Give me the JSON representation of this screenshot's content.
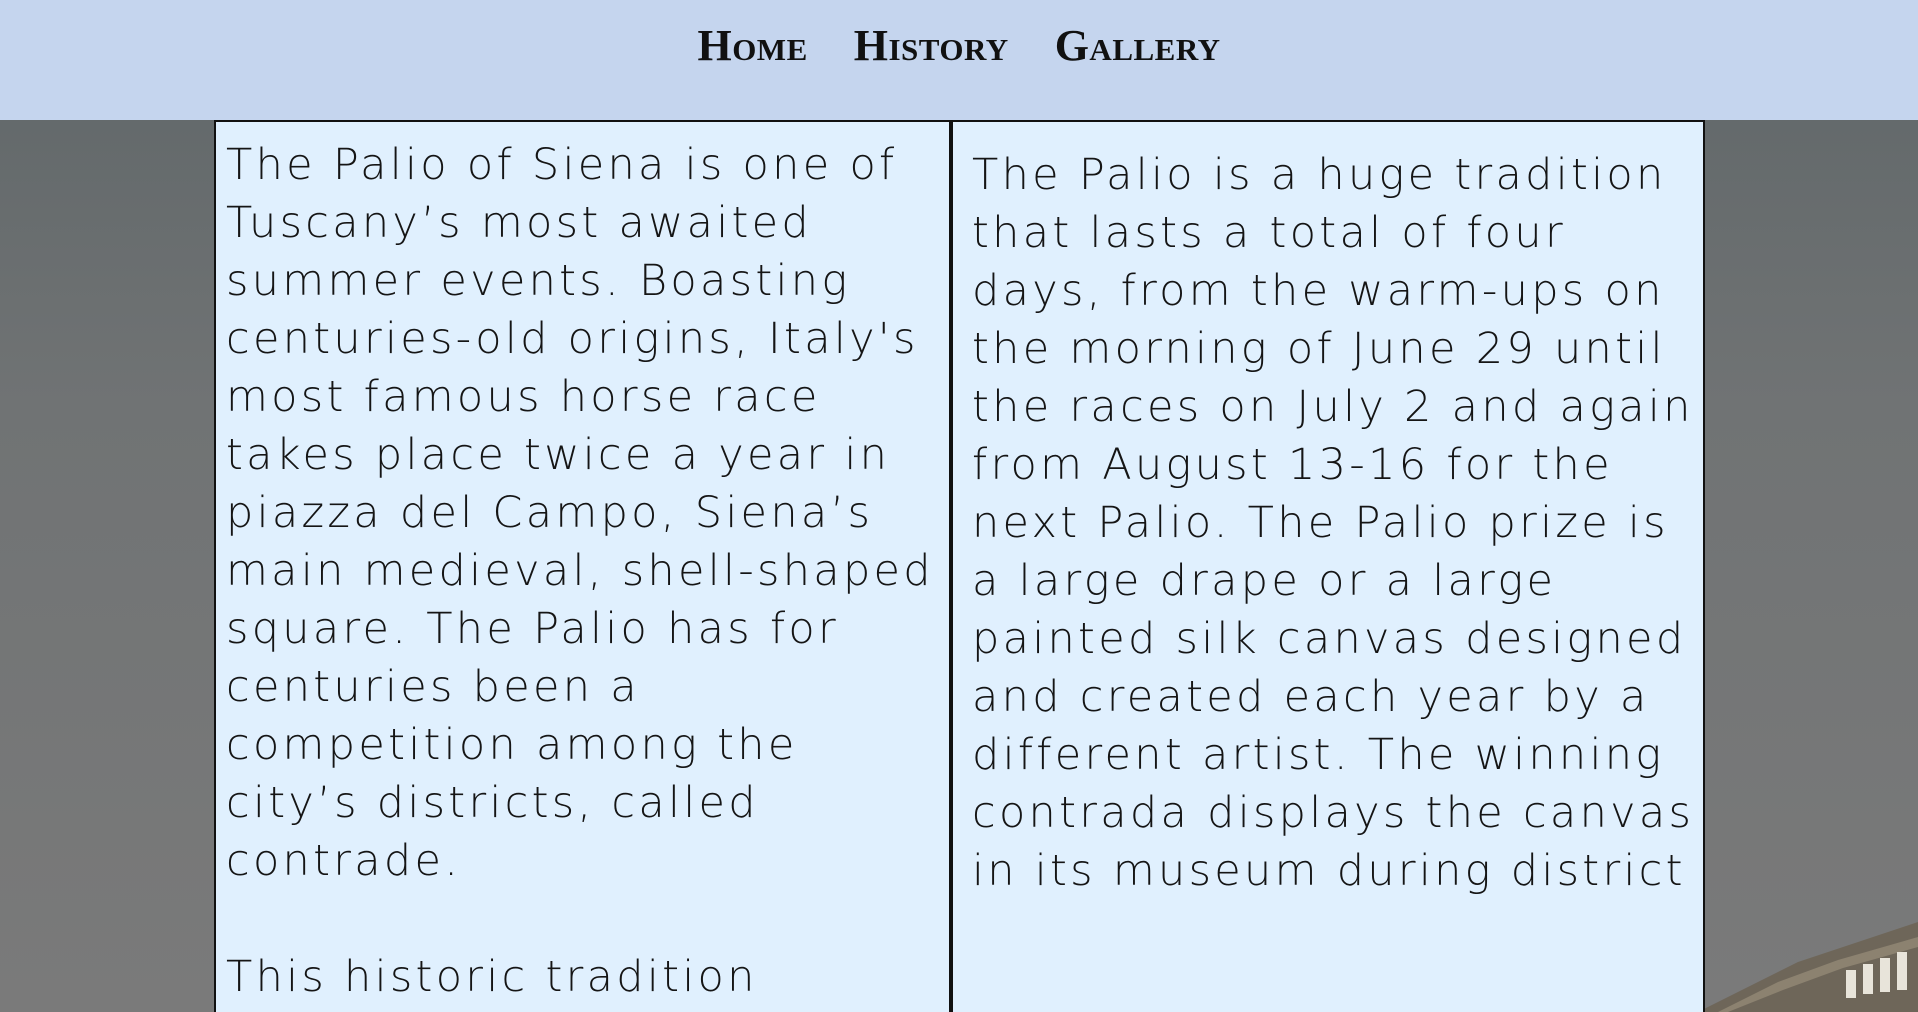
{
  "nav": {
    "links": [
      {
        "label": "Home"
      },
      {
        "label": "History"
      },
      {
        "label": "Gallery"
      }
    ]
  },
  "content": {
    "left": {
      "paragraphs": [
        "The Palio of Siena is one of Tuscany’s most awaited summer events. Boasting centuries-old origins, Italy's most famous horse race takes place twice a year in piazza del Campo, Siena’s main medieval, shell-shaped square. The Palio has for centuries been a competition among the city’s districts, called contrade.",
        "This historic tradition"
      ]
    },
    "right": {
      "paragraphs": [
        "The Palio is a huge tradition that lasts a total of four days, from the warm-ups on the morning of June 29 until the races on July 2 and again from August 13-16 for the next Palio. The Palio prize is a large drape or a large painted silk canvas designed and created each year by a different artist. The winning contrada displays the canvas in its museum during district"
      ]
    }
  },
  "colors": {
    "navbar_bg": "#c5d5ee",
    "panel_bg": "#e0f0fe",
    "border": "#111111",
    "text": "#151515"
  }
}
